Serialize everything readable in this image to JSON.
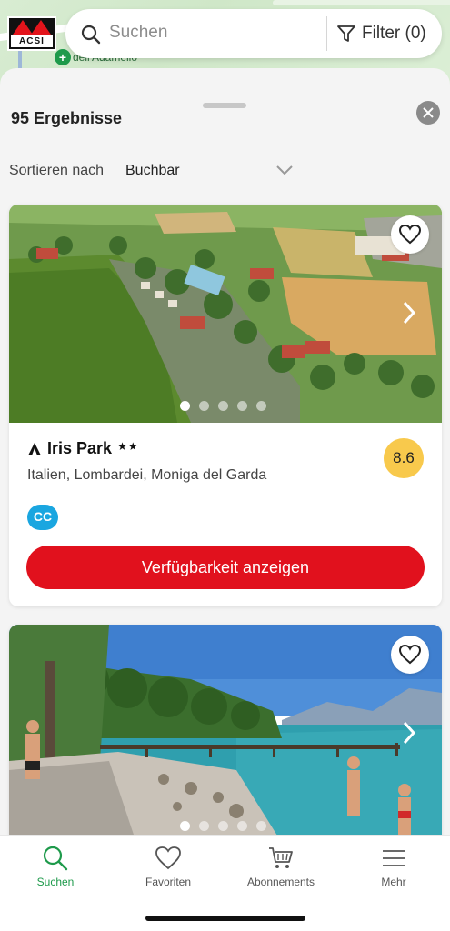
{
  "map": {
    "poi_label": "dell'Adamello",
    "poi_symbol": "+"
  },
  "logo": {
    "text": "ACSI"
  },
  "search": {
    "placeholder": "Suchen",
    "filter_label": "Filter (0)"
  },
  "sheet": {
    "results_label": "95 Ergebnisse",
    "sort_label": "Sortieren nach",
    "sort_value": "Buchbar"
  },
  "cards": [
    {
      "name": "Iris Park",
      "stars": "★★",
      "location": "Italien, Lombardei, Moniga del Garda",
      "rating": "8.6",
      "badge": "CC",
      "button_label": "Verfügbarkeit anzeigen",
      "photo_count": 5,
      "active_photo": 1
    },
    {
      "photo_count": 5,
      "active_photo": 1
    }
  ],
  "nav": {
    "items": [
      {
        "label": "Suchen",
        "icon": "search-icon",
        "active": true
      },
      {
        "label": "Favoriten",
        "icon": "heart-icon",
        "active": false
      },
      {
        "label": "Abonnements",
        "icon": "cart-icon",
        "active": false
      },
      {
        "label": "Mehr",
        "icon": "menu-icon",
        "active": false
      }
    ]
  },
  "colors": {
    "brand_red": "#e1111d",
    "active_green": "#1e9a4b",
    "rating_yellow": "#f8c94c",
    "cc_blue": "#1aa6e0"
  }
}
